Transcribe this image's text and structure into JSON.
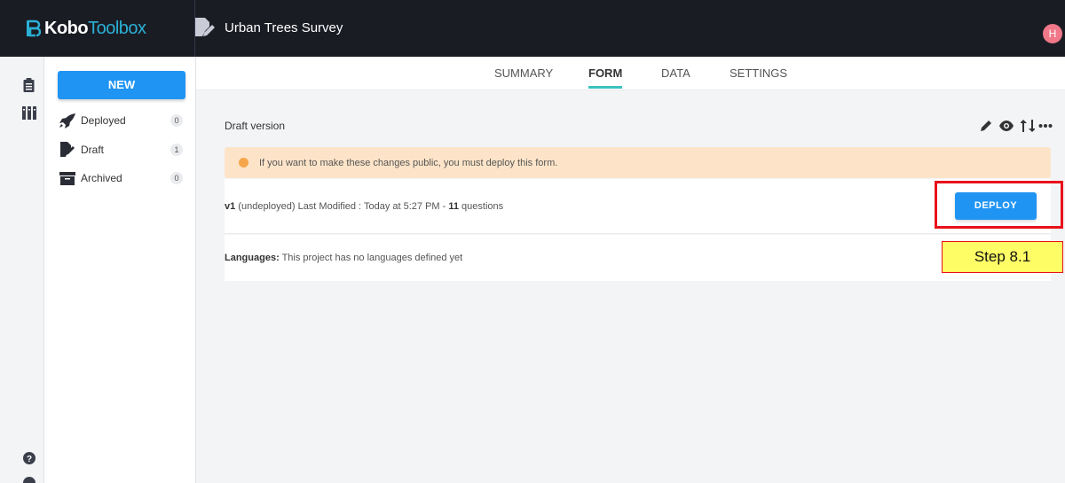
{
  "app": {
    "logo_kobo": "Kobo",
    "logo_toolbox": "Toolbox",
    "project_title": "Urban Trees Survey",
    "avatar_initial": "H"
  },
  "sidebar": {
    "new_label": "NEW",
    "items": [
      {
        "label": "Deployed",
        "count": "0"
      },
      {
        "label": "Draft",
        "count": "1"
      },
      {
        "label": "Archived",
        "count": "0"
      }
    ]
  },
  "tabs": [
    {
      "label": "SUMMARY"
    },
    {
      "label": "FORM"
    },
    {
      "label": "DATA"
    },
    {
      "label": "SETTINGS"
    }
  ],
  "form": {
    "draft_label": "Draft version",
    "alert_text": "If you want to make these changes public, you must deploy this form.",
    "version": "v1",
    "version_status": " (undeployed) Last Modified : Today at 5:27 PM - ",
    "question_count": "11",
    "question_suffix": " questions",
    "deploy_label": "DEPLOY",
    "languages_label": "Languages:",
    "languages_text": " This project has no languages defined yet"
  },
  "annotation": {
    "step_label": "Step 8.1"
  },
  "colors": {
    "topbar": "#1a1c24",
    "primary": "#2094f3",
    "tab_underline": "#3bc2c0",
    "alert_bg": "#fde4c8",
    "highlight": "#e8101b",
    "step_bg": "#fefd66"
  }
}
